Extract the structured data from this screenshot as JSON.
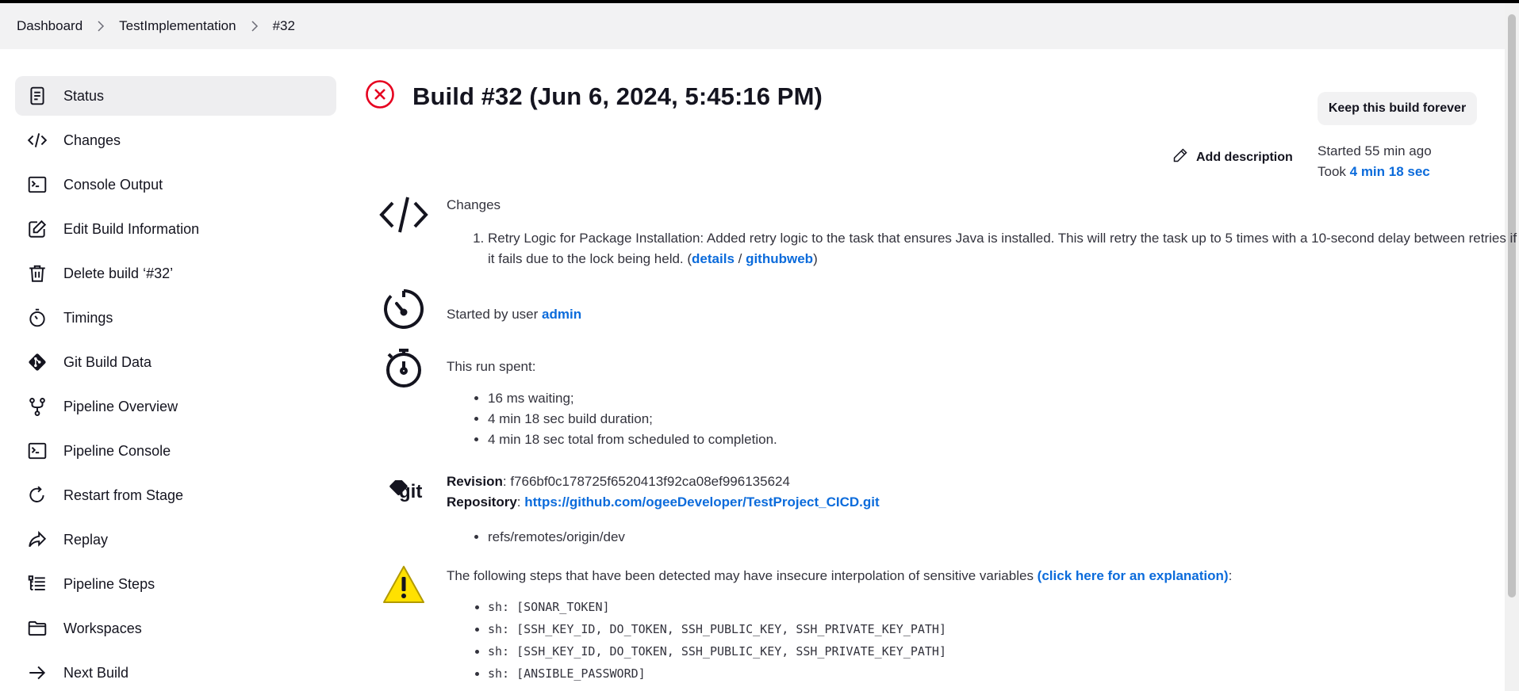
{
  "breadcrumb": [
    "Dashboard",
    "TestImplementation",
    "#32"
  ],
  "sidebar": {
    "items": [
      {
        "label": "Status",
        "icon": "document-icon"
      },
      {
        "label": "Changes",
        "icon": "code-icon"
      },
      {
        "label": "Console Output",
        "icon": "terminal-icon"
      },
      {
        "label": "Edit Build Information",
        "icon": "edit-icon"
      },
      {
        "label": "Delete build ‘#32’",
        "icon": "trash-icon"
      },
      {
        "label": "Timings",
        "icon": "stopwatch-icon"
      },
      {
        "label": "Git Build Data",
        "icon": "git-icon"
      },
      {
        "label": "Pipeline Overview",
        "icon": "branch-icon"
      },
      {
        "label": "Pipeline Console",
        "icon": "terminal-icon"
      },
      {
        "label": "Restart from Stage",
        "icon": "restart-icon"
      },
      {
        "label": "Replay",
        "icon": "replay-icon"
      },
      {
        "label": "Pipeline Steps",
        "icon": "list-icon"
      },
      {
        "label": "Workspaces",
        "icon": "folder-icon"
      },
      {
        "label": "Next Build",
        "icon": "arrow-right-icon"
      }
    ]
  },
  "build": {
    "title": "Build #32 (Jun 6, 2024, 5:45:16 PM)",
    "status_color": "#e6001f",
    "keep_label": "Keep this build forever",
    "add_description": "Add description",
    "started": "Started 55 min ago",
    "took_prefix": "Took ",
    "took_value": "4 min 18 sec"
  },
  "changes": {
    "heading": "Changes",
    "item_text": "Retry Logic for Package Installation: Added retry logic to the task that ensures Java is installed. This will retry the task up to 5 times with a 10-second delay between retries if it fails due to the lock being held. (",
    "details_link": "details",
    "slash": " / ",
    "githubweb_link": "githubweb",
    "close_paren": ")"
  },
  "started_by": {
    "prefix": "Started by user ",
    "user": "admin"
  },
  "run_spent": {
    "heading": "This run spent:",
    "items": [
      "16 ms waiting;",
      "4 min 18 sec build duration;",
      "4 min 18 sec total from scheduled to completion."
    ]
  },
  "git": {
    "revision_label": "Revision",
    "revision_value": "f766bf0c178725f6520413f92ca08ef996135624",
    "repository_label": "Repository",
    "repository_url": "https://github.com/ogeeDeveloper/TestProject_CICD.git",
    "branches": [
      "refs/remotes/origin/dev"
    ],
    "logo_text": "git"
  },
  "warning": {
    "text": "The following steps that have been detected may have insecure interpolation of sensitive variables ",
    "link": "(click here for an explanation)",
    "suffix": ":",
    "steps": [
      "sh: [SONAR_TOKEN]",
      "sh: [SSH_KEY_ID, DO_TOKEN, SSH_PUBLIC_KEY, SSH_PRIVATE_KEY_PATH]",
      "sh: [SSH_KEY_ID, DO_TOKEN, SSH_PUBLIC_KEY, SSH_PRIVATE_KEY_PATH]",
      "sh: [ANSIBLE_PASSWORD]"
    ]
  }
}
